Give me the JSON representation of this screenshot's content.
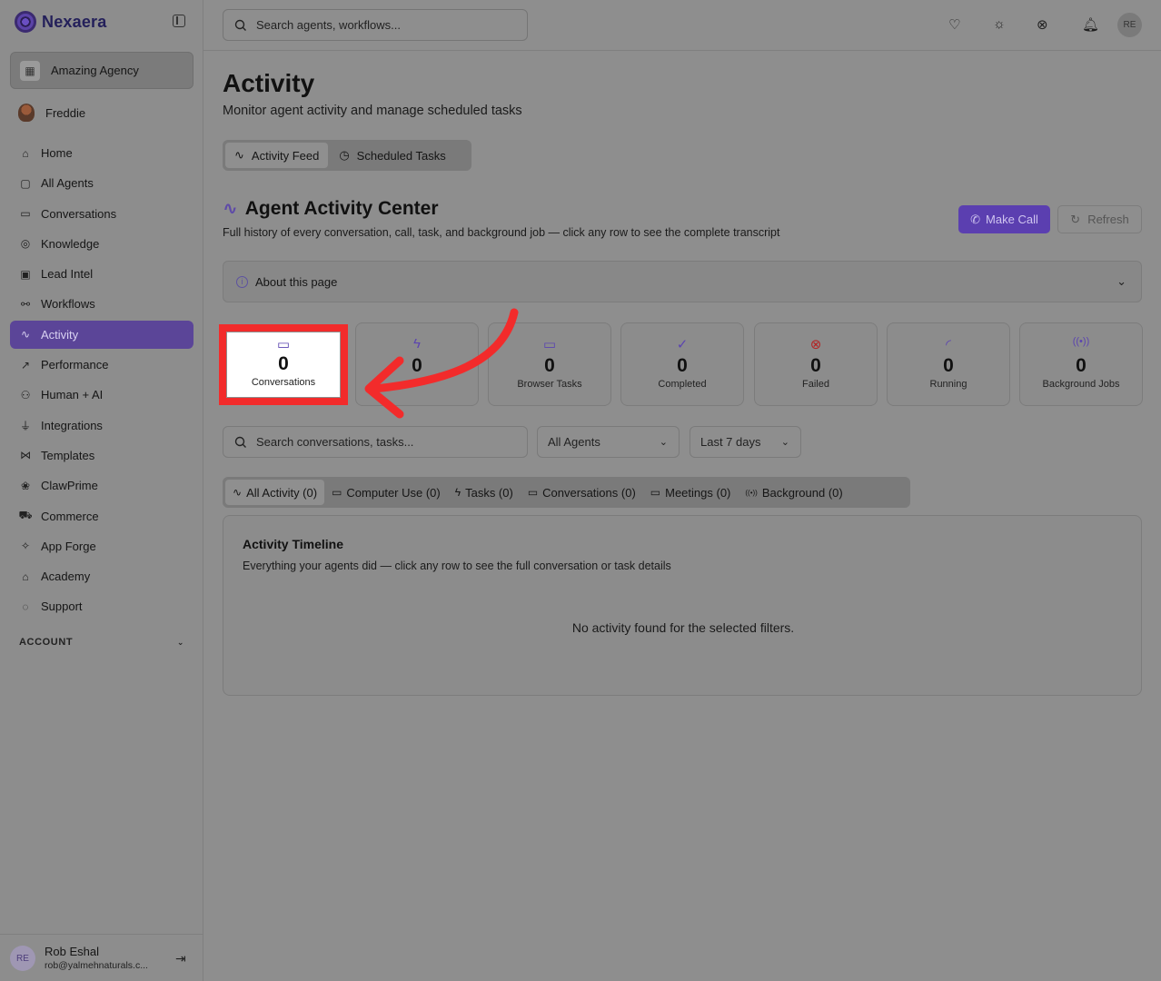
{
  "brand": {
    "name": "Nexaera"
  },
  "sidebar": {
    "agency": "Amazing Agency",
    "user": "Freddie",
    "items": [
      {
        "label": "Home",
        "icon": "home-icon"
      },
      {
        "label": "All Agents",
        "icon": "bot-icon"
      },
      {
        "label": "Conversations",
        "icon": "message-icon"
      },
      {
        "label": "Knowledge",
        "icon": "brain-icon"
      },
      {
        "label": "Lead Intel",
        "icon": "id-card-icon"
      },
      {
        "label": "Workflows",
        "icon": "workflow-icon"
      },
      {
        "label": "Activity",
        "icon": "activity-icon",
        "active": true
      },
      {
        "label": "Performance",
        "icon": "trending-up-icon"
      },
      {
        "label": "Human + AI",
        "icon": "people-icon"
      },
      {
        "label": "Integrations",
        "icon": "plug-icon"
      },
      {
        "label": "Templates",
        "icon": "share-icon"
      },
      {
        "label": "ClawPrime",
        "icon": "paw-icon"
      },
      {
        "label": "Commerce",
        "icon": "cart-icon"
      },
      {
        "label": "App Forge",
        "icon": "sparkles-icon"
      },
      {
        "label": "Academy",
        "icon": "graduation-cap-icon"
      },
      {
        "label": "Support",
        "icon": "help-circle-icon"
      }
    ],
    "account_label": "ACCOUNT",
    "footer": {
      "initials": "RE",
      "name": "Rob Eshal",
      "email": "rob@yalmehnaturals.c..."
    }
  },
  "topbar": {
    "search_placeholder": "Search agents, workflows...",
    "avatar_initials": "RE"
  },
  "page": {
    "title": "Activity",
    "subtitle": "Monitor agent activity and manage scheduled tasks",
    "view_tabs": [
      {
        "label": "Activity Feed",
        "active": true
      },
      {
        "label": "Scheduled Tasks",
        "active": false
      }
    ]
  },
  "center": {
    "title": "Agent Activity Center",
    "subtitle": "Full history of every conversation, call, task, and background job — click any row to see the complete transcript",
    "make_call": "Make Call",
    "refresh": "Refresh",
    "about": "About this page"
  },
  "stats": [
    {
      "value": "0",
      "label": "Conversations",
      "icon": "message-square-icon",
      "color": "#5b44b0",
      "highlighted": true
    },
    {
      "value": "0",
      "label": "",
      "icon": "zap-icon",
      "color": "#5b44b0"
    },
    {
      "value": "0",
      "label": "Browser Tasks",
      "icon": "monitor-play-icon",
      "color": "#5b44b0"
    },
    {
      "value": "0",
      "label": "Completed",
      "icon": "check-circle-icon",
      "color": "#5b44b0"
    },
    {
      "value": "0",
      "label": "Failed",
      "icon": "x-circle-icon",
      "color": "#b42424"
    },
    {
      "value": "0",
      "label": "Running",
      "icon": "loader-icon",
      "color": "#5b44b0"
    },
    {
      "value": "0",
      "label": "Background Jobs",
      "icon": "radio-icon",
      "color": "#5b44b0"
    }
  ],
  "filters": {
    "search_placeholder": "Search conversations, tasks...",
    "agent_select": "All Agents",
    "range_select": "Last 7 days"
  },
  "activity_tabs": [
    {
      "label": "All Activity (0)",
      "icon": "activity-icon",
      "active": true
    },
    {
      "label": "Computer Use (0)",
      "icon": "monitor-icon"
    },
    {
      "label": "Tasks (0)",
      "icon": "zap-icon"
    },
    {
      "label": "Conversations (0)",
      "icon": "message-icon"
    },
    {
      "label": "Meetings (0)",
      "icon": "video-icon"
    },
    {
      "label": "Background (0)",
      "icon": "radio-icon"
    }
  ],
  "timeline": {
    "title": "Activity Timeline",
    "subtitle": "Everything your agents did — click any row to see the full conversation or task details",
    "empty": "No activity found for the selected filters."
  },
  "annotation": {
    "color": "#f22b2b"
  }
}
